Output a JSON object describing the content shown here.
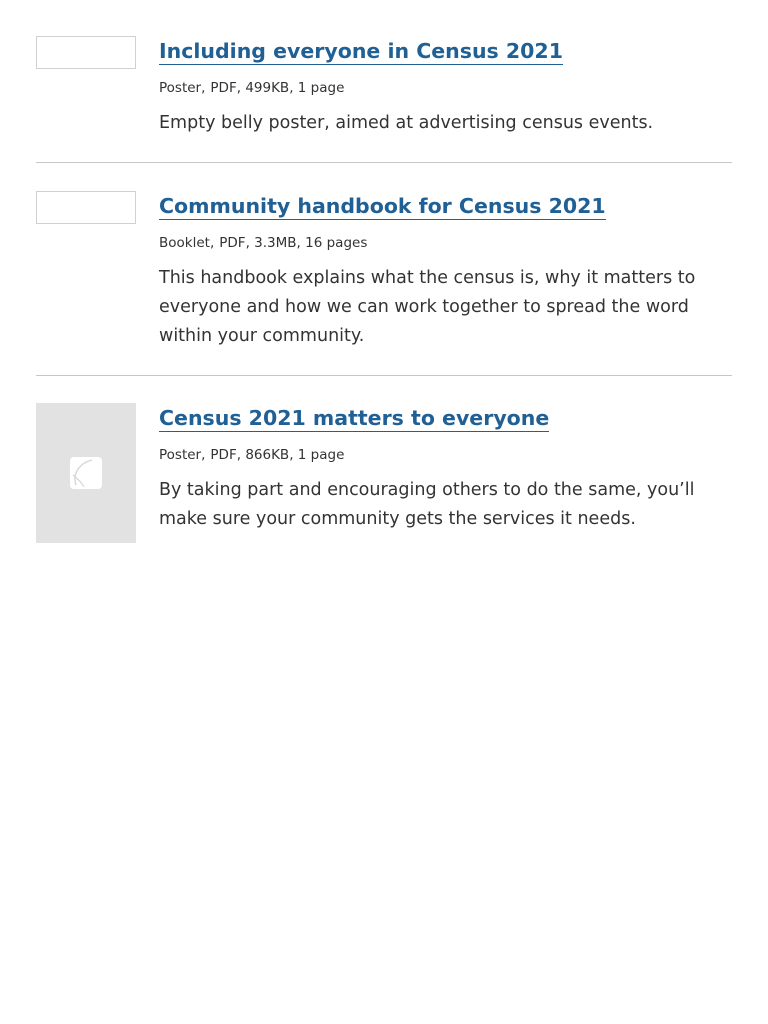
{
  "documents": [
    {
      "title": "Including everyone in Census 2021",
      "type": "Poster",
      "format": "PDF",
      "size": "499KB",
      "pages": "1 page",
      "description": "Empty belly poster, aimed at advertising census events.",
      "thumbnail": "blank"
    },
    {
      "title": "Community handbook for Census 2021",
      "type": "Booklet",
      "format": "PDF",
      "size": "3.3MB",
      "pages": "16 pages",
      "description": "This handbook explains what the census is, why it matters to everyone and how we can work together to spread the word within your community.",
      "thumbnail": "blank"
    },
    {
      "title": "Census 2021 matters to everyone",
      "type": "Poster",
      "format": "PDF",
      "size": "866KB",
      "pages": "1 page",
      "description": "By taking part and encouraging others to do the same, you’ll make sure your community gets the services it needs.",
      "thumbnail": "image-placeholder-icon"
    }
  ],
  "separator": ",",
  "colors": {
    "link": "#206095",
    "text": "#333333",
    "divider": "#c6c6c6",
    "thumbnail_bg": "#e2e2e2"
  }
}
